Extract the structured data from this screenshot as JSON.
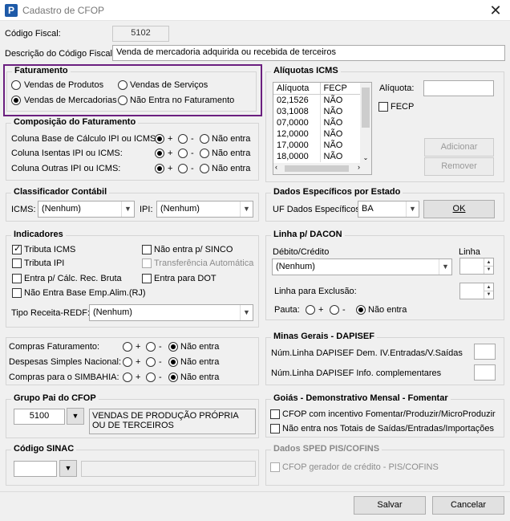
{
  "window": {
    "title": "Cadastro de CFOP",
    "close": "✕",
    "app_icon": "P"
  },
  "fields": {
    "codigo_label": "Código Fiscal:",
    "codigo_value": "5102",
    "descricao_label": "Descrição do Código Fiscal:",
    "descricao_value": "Venda de mercadoria adquirida ou recebida de terceiros"
  },
  "faturamento": {
    "title": "Faturamento",
    "options": [
      "Vendas de Produtos",
      "Vendas de Serviços",
      "Vendas de Mercadorias",
      "Não Entra no Faturamento"
    ],
    "selected": "Vendas de Mercadorias"
  },
  "composicao": {
    "title": "Composição do Faturamento",
    "rows": [
      {
        "label": "Coluna Base de Cálculo IPI ou ICMS:",
        "selected": "+"
      },
      {
        "label": "Coluna Isentas IPI ou ICMS:",
        "selected": "+"
      },
      {
        "label": "Coluna Outras IPI ou ICMS:",
        "selected": "+"
      }
    ],
    "opt_plus": "+",
    "opt_minus": "-",
    "opt_none": "Não entra"
  },
  "aliquotas": {
    "title": "Alíquotas ICMS",
    "headers": [
      "Alíquota",
      "FECP"
    ],
    "rows": [
      [
        "02,1526",
        "NÃO"
      ],
      [
        "03,1008",
        "NÃO"
      ],
      [
        "07,0000",
        "NÃO"
      ],
      [
        "12,0000",
        "NÃO"
      ],
      [
        "17,0000",
        "NÃO"
      ],
      [
        "18,0000",
        "NÃO"
      ]
    ],
    "aliquota_label": "Alíquota:",
    "fecp_label": "FECP",
    "add_button": "Adicionar",
    "remove_button": "Remover"
  },
  "classificador": {
    "title": "Classificador Contábil",
    "icms_label": "ICMS:",
    "icms_value": "(Nenhum)",
    "ipi_label": "IPI:",
    "ipi_value": "(Nenhum)"
  },
  "dados_estado": {
    "title": "Dados Específicos por Estado",
    "uf_label": "UF Dados Específicos:",
    "uf_value": "BA",
    "ok_button": "OK"
  },
  "indicadores": {
    "title": "Indicadores",
    "items": [
      {
        "label": "Tributa ICMS",
        "checked": true,
        "disabled": false
      },
      {
        "label": "Não entra p/ SINCO",
        "checked": false,
        "disabled": false
      },
      {
        "label": "Tributa IPI",
        "checked": false,
        "disabled": false
      },
      {
        "label": "Transferência Automática",
        "checked": false,
        "disabled": true
      },
      {
        "label": "Entra p/ Cálc. Rec. Bruta",
        "checked": false,
        "disabled": false
      },
      {
        "label": "Entra para DOT",
        "checked": false,
        "disabled": false
      },
      {
        "label": "Não Entra Base Emp.Alim.(RJ)",
        "checked": false,
        "disabled": false
      }
    ],
    "tipo_receita_label": "Tipo Receita-REDF:",
    "tipo_receita_value": "(Nenhum)"
  },
  "dacon": {
    "title": "Linha p/ DACON",
    "debito_label": "Débito/Crédito",
    "debito_value": "(Nenhum)",
    "linha_label": "Linha",
    "exclusao_label": "Linha para Exclusão:",
    "pauta_label": "Pauta:",
    "pauta_selected": "Não entra"
  },
  "compras": {
    "rows": [
      {
        "label": "Compras Faturamento:",
        "selected": "Não entra"
      },
      {
        "label": "Despesas Simples Nacional:",
        "selected": "Não entra"
      },
      {
        "label": "Compras para o SIMBAHIA:",
        "selected": "Não entra"
      }
    ]
  },
  "minas": {
    "title": "Minas Gerais - DAPISEF",
    "row1": "Núm.Linha DAPISEF Dem. IV.Entradas/V.Saídas",
    "row2": "Núm.Linha DAPISEF Info. complementares"
  },
  "grupo_pai": {
    "title": "Grupo Pai do CFOP",
    "code": "5100",
    "description": "VENDAS DE PRODUÇÃO PRÓPRIA OU DE TERCEIROS"
  },
  "goias": {
    "title": "Goiás - Demonstrativo Mensal - Fomentar",
    "opt1": "CFOP com incentivo  Fomentar/Produzir/MicroProduzir",
    "opt2": "Não entra nos Totais de  Saídas/Entradas/Importações"
  },
  "sinac": {
    "title": "Código SINAC"
  },
  "sped": {
    "title": "Dados SPED PIS/COFINS",
    "opt": "CFOP gerador de crédito - PIS/COFINS"
  },
  "footer": {
    "save": "Salvar",
    "cancel": "Cancelar"
  }
}
